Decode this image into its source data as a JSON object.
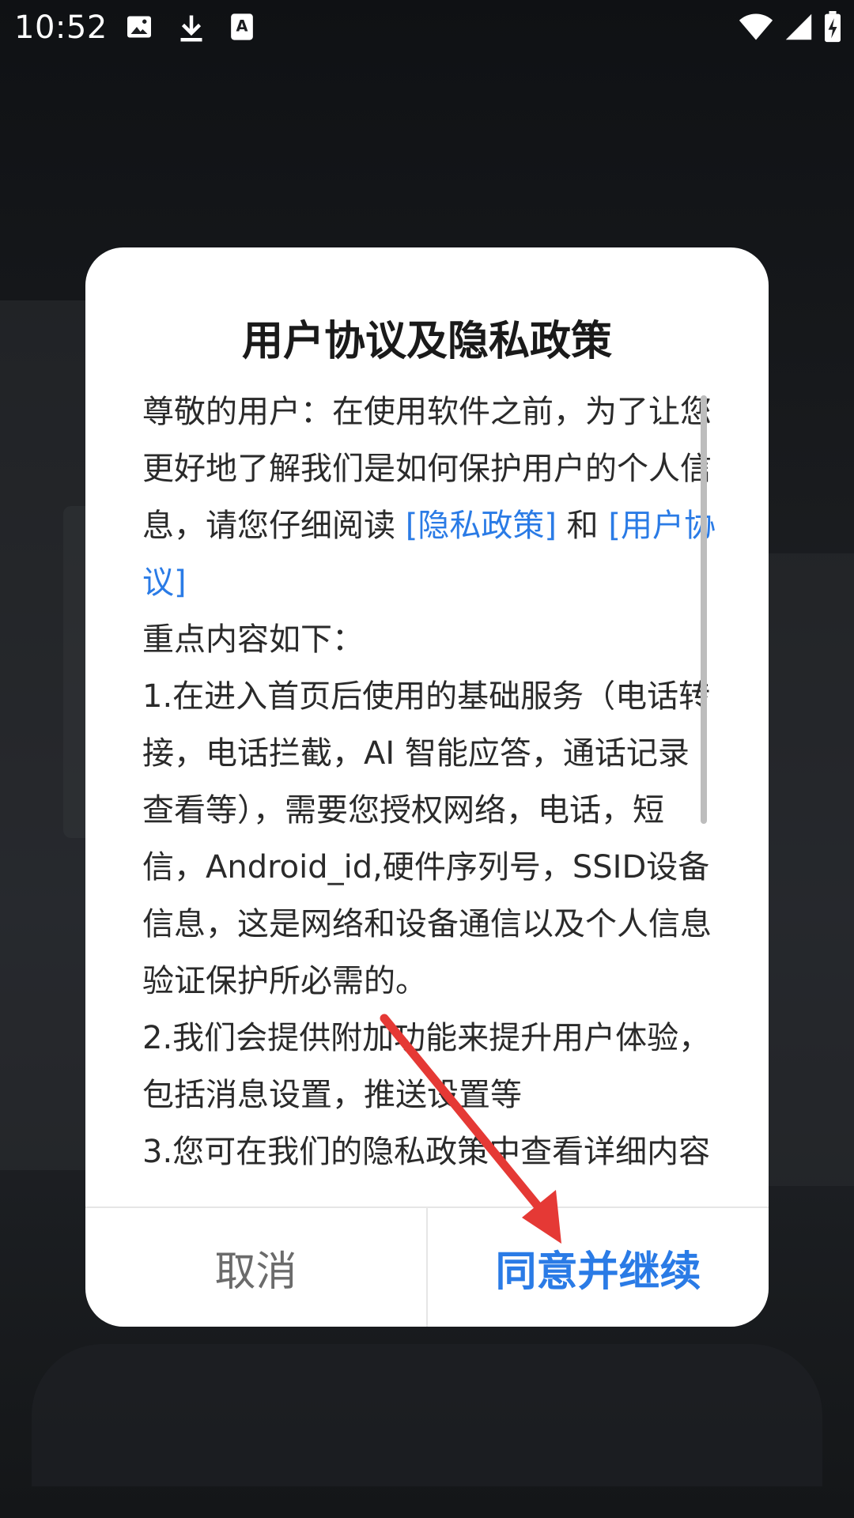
{
  "status_bar": {
    "time": "10:52",
    "left_icons": [
      "image-icon",
      "download-icon",
      "font-icon"
    ],
    "right_icons": [
      "wifi-icon",
      "signal-icon",
      "battery-charging-icon"
    ]
  },
  "dialog": {
    "title": "用户协议及隐私政策",
    "body": {
      "p1_text": "尊敬的用户：在使用软件之前，为了让您更好地了解我们是如何保护用户的个人信息，请您仔细阅读 ",
      "privacy_link": "[隐私政策]",
      "and_text": " 和 ",
      "agreement_link": "[用户协议]",
      "p2": "重点内容如下：",
      "p3": "1.在进入首页后使用的基础服务（电话转接，电话拦截，AI 智能应答，通话记录查看等），需要您授权网络，电话，短信，Android_id,硬件序列号，SSID设备信息，这是网络和设备通信以及个人信息验证保护所必需的。",
      "p4": "2.我们会提供附加功能来提升用户体验，包括消息设置，推送设置等",
      "p5": "3.您可在我们的隐私政策中查看详细内容"
    },
    "cancel_label": "取消",
    "agree_label": "同意并继续"
  },
  "colors": {
    "link": "#2a7be6",
    "annotation_arrow": "#e53935"
  }
}
